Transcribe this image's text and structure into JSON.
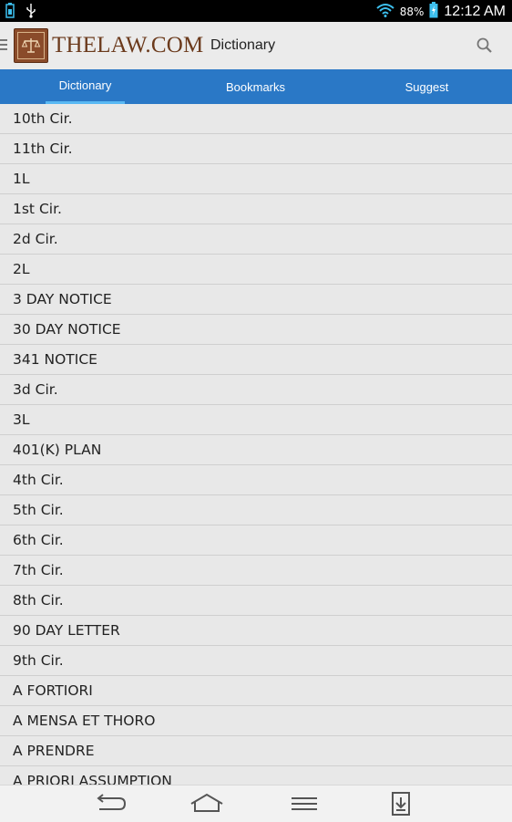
{
  "status_bar": {
    "battery_percent": "88%",
    "time": "12:12 AM"
  },
  "action_bar": {
    "logo_text": "THELAW.COM",
    "title": "Dictionary"
  },
  "tabs": [
    {
      "label": "Dictionary",
      "active": true
    },
    {
      "label": "Bookmarks",
      "active": false
    },
    {
      "label": "Suggest",
      "active": false
    }
  ],
  "terms": [
    "10th Cir.",
    "11th Cir.",
    "1L",
    "1st Cir.",
    "2d Cir.",
    "2L",
    "3 DAY NOTICE",
    "30 DAY NOTICE",
    "341 NOTICE",
    "3d Cir.",
    "3L",
    "401(K) PLAN",
    "4th Cir.",
    "5th Cir.",
    "6th Cir.",
    "7th Cir.",
    "8th Cir.",
    "90 DAY LETTER",
    "9th Cir.",
    "A FORTIORI",
    "A MENSA ET THORO",
    "A PRENDRE",
    "A PRIORI ASSUMPTION"
  ],
  "colors": {
    "tab_bar": "#2a78c6",
    "tab_indicator": "#59b8f3",
    "logo_brown": "#6b3a1c"
  }
}
